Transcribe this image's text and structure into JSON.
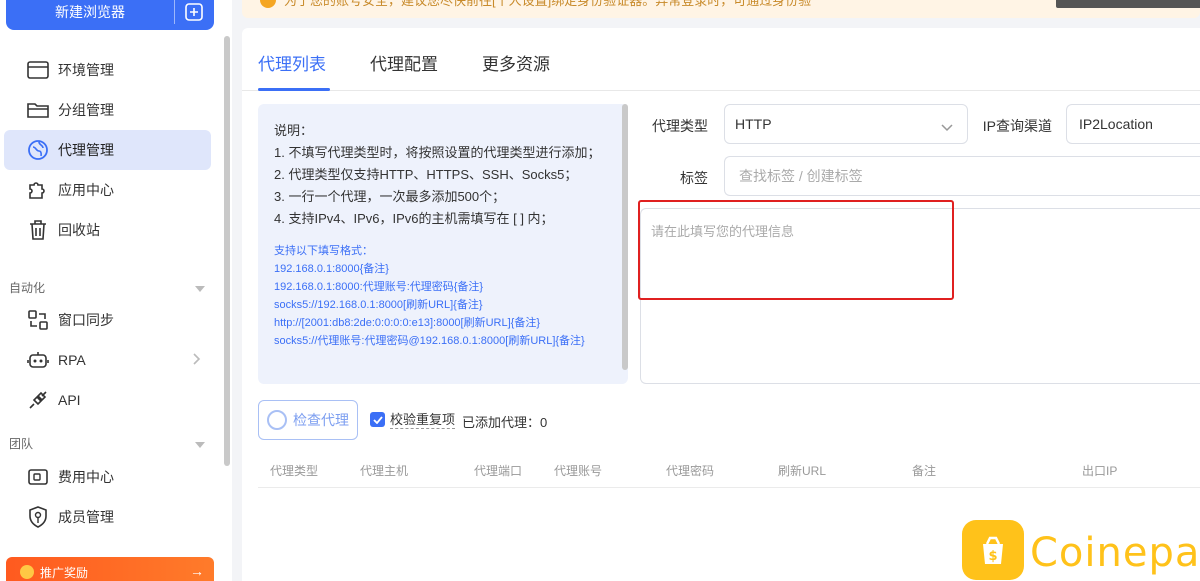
{
  "sidebar": {
    "new_browser": "新建浏览器",
    "items": [
      {
        "label": "环境管理",
        "icon": "browser-window-icon"
      },
      {
        "label": "分组管理",
        "icon": "folder-icon"
      },
      {
        "label": "代理管理",
        "icon": "proxy-globe-icon"
      },
      {
        "label": "应用中心",
        "icon": "puzzle-icon"
      },
      {
        "label": "回收站",
        "icon": "trash-icon"
      }
    ],
    "group_automation": "自动化",
    "automation_items": [
      {
        "label": "窗口同步",
        "icon": "window-sync-icon"
      },
      {
        "label": "RPA",
        "icon": "robot-icon"
      },
      {
        "label": "API",
        "icon": "plug-icon"
      }
    ],
    "group_team": "团队",
    "team_items": [
      {
        "label": "费用中心",
        "icon": "wallet-icon"
      },
      {
        "label": "成员管理",
        "icon": "shield-user-icon"
      }
    ],
    "promo": "推广奖励"
  },
  "notice": {
    "text": "为了您的账号安全，建议您尽快前往[个人设置]绑定身份验证器。异常登录时，可通过身份验"
  },
  "tabs": [
    "代理列表",
    "代理配置",
    "更多资源"
  ],
  "info": {
    "title": "说明：",
    "lines": [
      "1. 不填写代理类型时，将按照设置的代理类型进行添加；",
      "2. 代理类型仅支持HTTP、HTTPS、SSH、Socks5；",
      "3. 一行一个代理，一次最多添加500个；",
      "4. 支持IPv4、IPv6，IPv6的主机需填写在 [ ] 内；"
    ],
    "formats_title": "支持以下填写格式：",
    "formats": [
      "192.168.0.1:8000{备注}",
      "192.168.0.1:8000:代理账号:代理密码{备注}",
      "socks5://192.168.0.1:8000[刷新URL]{备注}",
      "http://[2001:db8:2de:0:0:0:0:e13]:8000[刷新URL]{备注}",
      "socks5://代理账号:代理密码@192.168.0.1:8000[刷新URL]{备注}"
    ]
  },
  "form": {
    "proxy_type_label": "代理类型",
    "proxy_type_value": "HTTP",
    "ip_channel_label": "IP查询渠道",
    "ip_channel_value": "IP2Location",
    "tag_label": "标签",
    "tag_placeholder": "查找标签 / 创建标签",
    "textarea_placeholder": "请在此填写您的代理信息"
  },
  "actions": {
    "check_label": "检查代理",
    "dedupe_label": "校验重复项",
    "dedupe_checked": true,
    "added_label": "已添加代理：",
    "added_count": "0"
  },
  "table": {
    "columns": [
      "代理类型",
      "代理主机",
      "代理端口",
      "代理账号",
      "代理密码",
      "刷新URL",
      "备注",
      "出口IP"
    ]
  },
  "watermark": "Coinepay",
  "colors": {
    "accent": "#3b6ff6",
    "highlight": "#e02020",
    "promo": "#ff5a1f",
    "watermark": "#ffc21a"
  }
}
